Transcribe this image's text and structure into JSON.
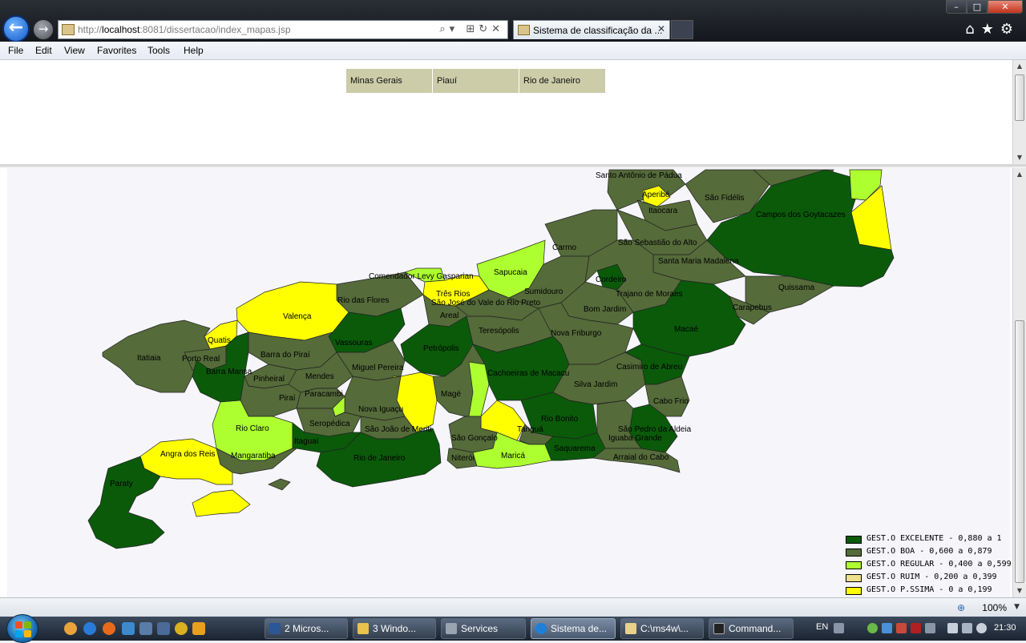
{
  "browser": {
    "url_prefix": "http://",
    "url_host": "localhost",
    "url_rest": ":8081/dissertacao/index_mapas.jsp",
    "tab_title": "Sistema de classificação da ...",
    "address_tools": "⌕▾ ⊞↻✕",
    "nav_right_icons": "⌂★⚙"
  },
  "menu": {
    "items": [
      "File",
      "Edit",
      "View",
      "Favorites",
      "Tools",
      "Help"
    ]
  },
  "states": [
    "Minas Gerais",
    "Piauí",
    "Rio de Janeiro"
  ],
  "map": {
    "colors": {
      "excelente": "#0a5a0a",
      "boa": "#556b3a",
      "regular": "#adff2f",
      "ruim": "#eee08c",
      "pessima": "#ffff00",
      "background": "#f5f5fa"
    },
    "municipalities": [
      "Santo Antônio de Pádua",
      "Aperibé",
      "Itaocara",
      "São Fidélis",
      "Campos dos Goytacazes",
      "Carmo",
      "São Sebastião do Alto",
      "Santa Maria Madalena",
      "Quissama",
      "Comendador Levy Gasparian",
      "Sapucaia",
      "Três Rios",
      "São José do Vale do Rio Preto",
      "Sumidouro",
      "Cordeiro",
      "Trajano de Moraes",
      "Rio das Flores",
      "Valença",
      "Areal",
      "Bom Jardim",
      "Carapebus",
      "Macaé",
      "Teresópolis",
      "Nova Friburgo",
      "Quatis",
      "Itatiaia",
      "Porto Real",
      "Vassouras",
      "Barra do Piraí",
      "Petrópolis",
      "Barra Mansa",
      "Miguel Pereira",
      "Pinheiral",
      "Mendes",
      "Cachoeiras de Macacu",
      "Casimiro de Abreu",
      "Silva Jardim",
      "Piraí",
      "Paracambi",
      "Magé",
      "Rio Claro",
      "Nova Iguaçu",
      "Cabo Frio",
      "Seropédica",
      "Rio Bonito",
      "São João de Meriti",
      "São Gonçalo",
      "Tanguá",
      "São Pedro da Aldeia",
      "Itaguaí",
      "Iguaba Grande",
      "Angra dos Reis",
      "Mangaratiba",
      "Rio de Janeiro",
      "Niterói",
      "Maricá",
      "Saquarema",
      "Arraial do Cabo",
      "Paraty"
    ]
  },
  "legend": [
    {
      "label": "GEST.O EXCELENTE - 0,880 a 1",
      "color": "#0a5a0a"
    },
    {
      "label": "GEST.O BOA - 0,600 a 0,879",
      "color": "#556b3a"
    },
    {
      "label": "GEST.O REGULAR - 0,400 a 0,599",
      "color": "#adff2f"
    },
    {
      "label": "GEST.O RUIM - 0,200 a 0,399",
      "color": "#eee08c"
    },
    {
      "label": "GEST.O P.SSIMA - 0 a 0,199",
      "color": "#ffff00"
    }
  ],
  "status": {
    "zoom": "100%"
  },
  "taskbar": {
    "buttons": [
      {
        "label": "2 Micros...",
        "color": "#2b5797"
      },
      {
        "label": "3 Windo...",
        "color": "#e8c24a"
      },
      {
        "label": "Services",
        "color": "#9aa4b0"
      },
      {
        "label": "Sistema de...",
        "color": "#1e7fd8"
      },
      {
        "label": "C:\\ms4w\\...",
        "color": "#e8d18a"
      },
      {
        "label": "Command...",
        "color": "#222222"
      }
    ],
    "language": "EN",
    "clock": "21:30"
  }
}
